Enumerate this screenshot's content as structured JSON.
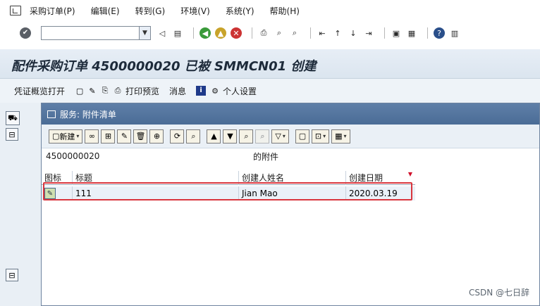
{
  "menu": {
    "items": [
      "采购订单(P)",
      "编辑(E)",
      "转到(G)",
      "环境(V)",
      "系统(Y)",
      "帮助(H)"
    ]
  },
  "toolbar": {
    "command_value": "",
    "icons": [
      "enter-icon",
      "save-icon",
      "back-icon",
      "exit-icon",
      "cancel-icon",
      "print-icon",
      "find-icon",
      "find-next-icon",
      "first-page-icon",
      "prev-page-icon",
      "next-page-icon",
      "last-page-icon",
      "create-session-icon",
      "shortcut-icon",
      "help-icon",
      "layout-icon"
    ]
  },
  "title": "配件采购订单 4500000020 已被 SMMCN01 创建",
  "app_toolbar": {
    "overview": "凭证概览打开",
    "print_preview": "打印预览",
    "messages": "消息",
    "personal_settings": "个人设置"
  },
  "popup": {
    "title": "服务: 附件清单",
    "toolbar": {
      "create_label": "新建"
    },
    "doc_number": "4500000020",
    "attachments_label": "的附件",
    "columns": [
      "图标",
      "标题",
      "创建人姓名",
      "创建日期"
    ],
    "rows": [
      {
        "title": "111",
        "creator": "Jian Mao",
        "date": "2020.03.19"
      }
    ]
  },
  "watermark": "CSDN @七日辞"
}
